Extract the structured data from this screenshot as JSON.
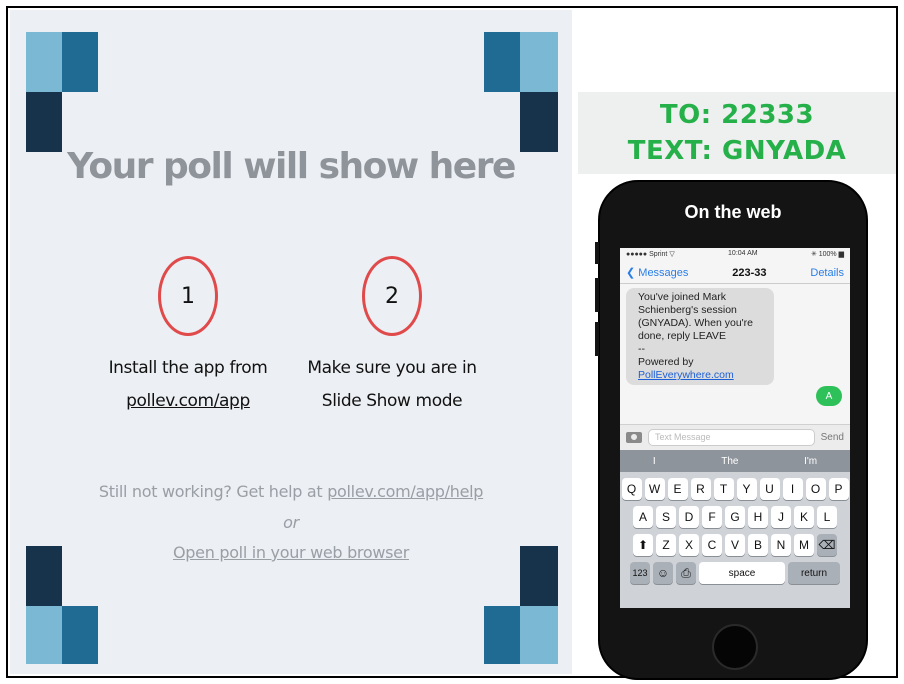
{
  "poll": {
    "title": "Your poll will show here",
    "steps": [
      {
        "number": "1",
        "line1": "Install the app from",
        "link": "pollev.com/app"
      },
      {
        "number": "2",
        "line1": "Make sure you are in",
        "line2": "Slide Show mode"
      }
    ],
    "help_prefix": "Still not working? Get help at ",
    "help_link": "pollev.com/app/help",
    "or": "or",
    "browser_link": "Open poll in your web browser"
  },
  "banner": {
    "to": "TO: 22333",
    "text": "TEXT: GNYADA"
  },
  "phone": {
    "header": "On the web",
    "status": {
      "carrier": "●●●●● Sprint ▽",
      "time": "10:04 AM",
      "battery": "✳ 100% ▆"
    },
    "nav": {
      "back": "Messages",
      "title": "223-33",
      "details": "Details"
    },
    "message_lines": [
      "You've joined Mark",
      "Schienberg's session",
      "(GNYADA). When you're",
      "done, reply LEAVE",
      "--",
      "Powered by"
    ],
    "message_link": "PollEverywhere.com",
    "sent": "A",
    "input_placeholder": "Text Message",
    "send": "Send",
    "suggestions": [
      "I",
      "The",
      "I'm"
    ],
    "row1": [
      "Q",
      "W",
      "E",
      "R",
      "T",
      "Y",
      "U",
      "I",
      "O",
      "P"
    ],
    "row2": [
      "A",
      "S",
      "D",
      "F",
      "G",
      "H",
      "J",
      "K",
      "L"
    ],
    "row3": [
      "Z",
      "X",
      "C",
      "V",
      "B",
      "N",
      "M"
    ],
    "shift": "⬆",
    "delete": "⌫",
    "key_123": "123",
    "emoji": "☺",
    "mic": "⎙",
    "space": "space",
    "return": "return"
  },
  "colors": {
    "accent_green": "#26b04a",
    "circle_red": "#e04a4a",
    "tile_light": "#7ab8d4",
    "tile_mid": "#1f6b93",
    "tile_dark": "#17324b"
  }
}
